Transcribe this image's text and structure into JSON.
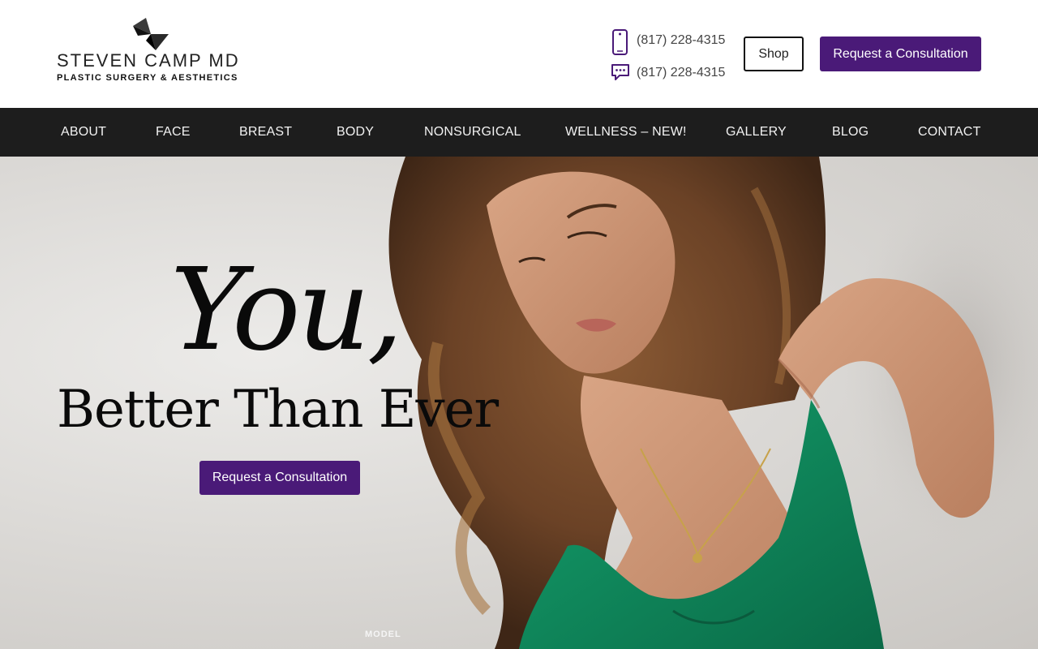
{
  "brand": {
    "name": "STEVEN CAMP MD",
    "tagline": "PLASTIC SURGERY & AESTHETICS"
  },
  "contact": {
    "phone": "(817) 228-4315",
    "text": "(817) 228-4315"
  },
  "header_buttons": {
    "shop": "Shop",
    "consult": "Request a Consultation"
  },
  "nav": {
    "items": [
      "ABOUT",
      "FACE",
      "BREAST",
      "BODY",
      "NONSURGICAL",
      "WELLNESS – NEW!",
      "GALLERY",
      "BLOG",
      "CONTACT"
    ]
  },
  "hero": {
    "headline": "You,",
    "subheadline": "Better Than Ever",
    "cta": "Request a Consultation",
    "photo_caption": "MODEL"
  },
  "colors": {
    "accent": "#4a1a78",
    "nav_bg": "#1d1d1d",
    "dress": "#0f8a5e"
  },
  "icons": [
    "logo-bowtie-icon",
    "mobile-phone-icon",
    "chat-bubble-icon"
  ]
}
